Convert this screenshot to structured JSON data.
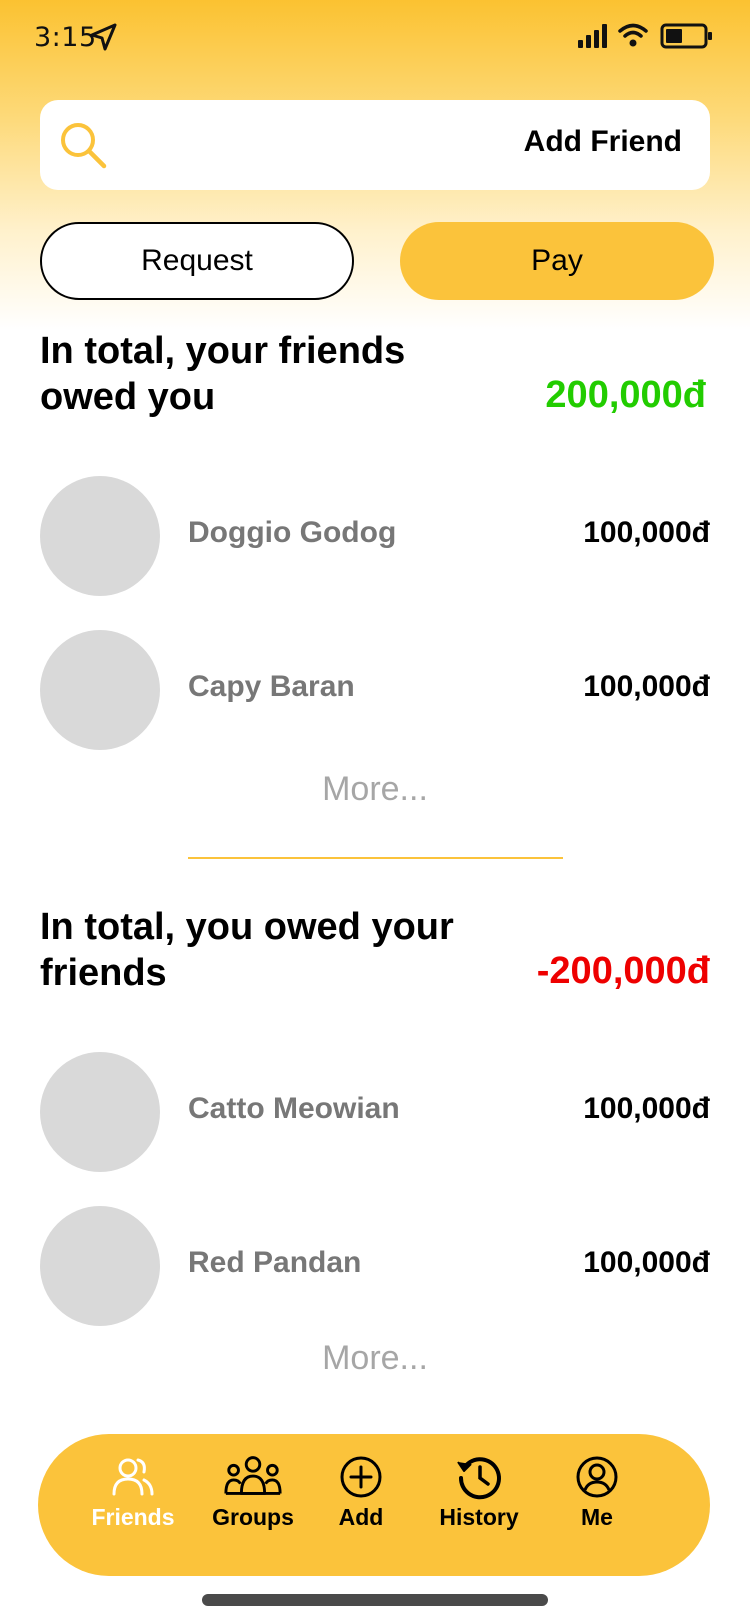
{
  "status_bar": {
    "time": "3:15"
  },
  "search": {
    "placeholder": "",
    "add_friend_label": "Add Friend"
  },
  "actions": {
    "request_label": "Request",
    "pay_label": "Pay"
  },
  "owed_to_you": {
    "title": "In total, your friends owed you",
    "total": "200,000đ",
    "total_color": "#22cc00",
    "friends": [
      {
        "name": "Doggio Godog",
        "amount": "100,000đ"
      },
      {
        "name": "Capy Baran",
        "amount": "100,000đ"
      }
    ],
    "more_label": "More..."
  },
  "you_owe": {
    "title": "In total, you owed your friends",
    "total": "-200,000đ",
    "total_color": "#ee0000",
    "friends": [
      {
        "name": "Catto Meowian",
        "amount": "100,000đ"
      },
      {
        "name": "Red Pandan",
        "amount": "100,000đ"
      }
    ],
    "more_label": "More..."
  },
  "nav": {
    "items": [
      {
        "label": "Friends",
        "icon": "friends-icon",
        "active": true
      },
      {
        "label": "Groups",
        "icon": "groups-icon",
        "active": false
      },
      {
        "label": "Add",
        "icon": "add-circle-icon",
        "active": false
      },
      {
        "label": "History",
        "icon": "history-icon",
        "active": false
      },
      {
        "label": "Me",
        "icon": "profile-icon",
        "active": false
      }
    ]
  },
  "colors": {
    "accent": "#fbc33b",
    "avatar_placeholder": "#d9d9d9"
  }
}
